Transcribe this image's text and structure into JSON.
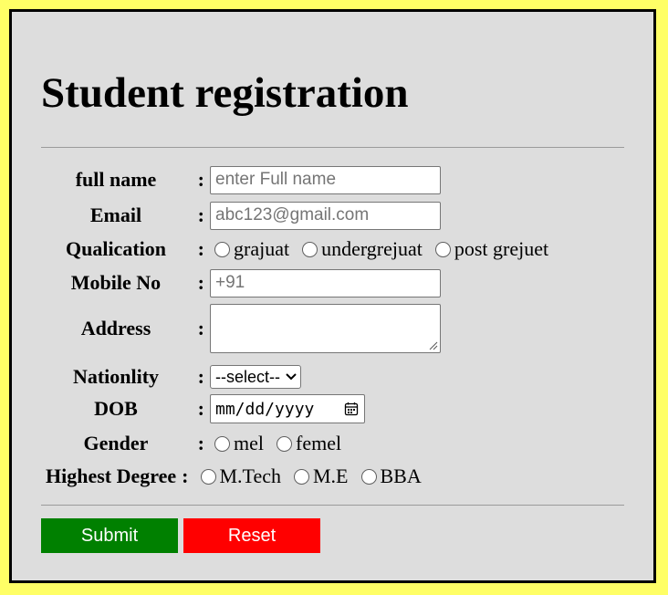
{
  "page": {
    "title": "Student registration"
  },
  "form": {
    "full_name": {
      "label": "full name",
      "colon": ":",
      "placeholder": "enter Full name"
    },
    "email": {
      "label": "Email",
      "colon": ":",
      "placeholder": "abc123@gmail.com"
    },
    "qualification": {
      "label": "Qualication",
      "colon": ":",
      "options": [
        "grajuat",
        "undergrejuat",
        "post grejuet"
      ]
    },
    "mobile": {
      "label": "Mobile No",
      "colon": ":",
      "placeholder": "+91"
    },
    "address": {
      "label": "Address",
      "colon": ":"
    },
    "nationality": {
      "label": "Nationlity",
      "colon": ":",
      "selected": "--select--"
    },
    "dob": {
      "label": "DOB",
      "colon": ":",
      "value": "mm/dd/yyyy"
    },
    "gender": {
      "label": "Gender",
      "colon": ":",
      "options": [
        "mel",
        "femel"
      ]
    },
    "degree": {
      "label": "Highest Degree",
      "colon": ":",
      "options": [
        "M.Tech",
        "M.E",
        "BBA"
      ]
    }
  },
  "buttons": {
    "submit": "Submit",
    "reset": "Reset"
  },
  "colors": {
    "frame": "#ffff66",
    "panel": "#dddddd",
    "submit": "#008000",
    "reset": "#ff0000"
  },
  "icons": {
    "date_picker": "calendar-icon",
    "dropdown": "chevron-down-icon",
    "resize": "resize-grip-icon"
  }
}
